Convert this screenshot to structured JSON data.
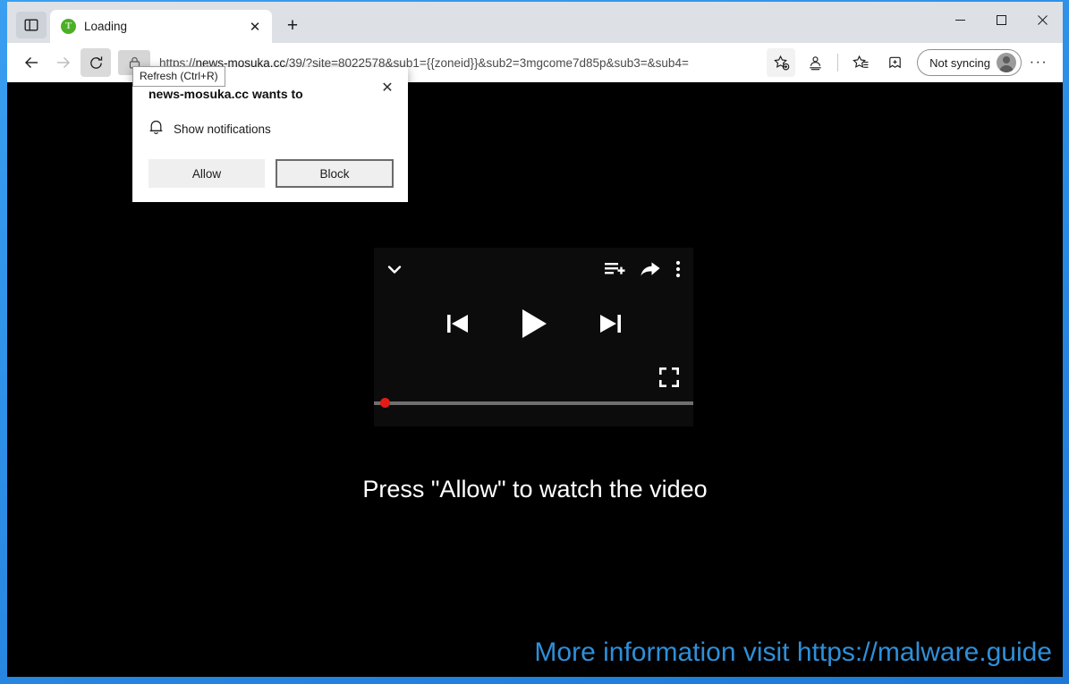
{
  "window": {
    "minimize_label": "—",
    "maximize_label": "☐",
    "close_label": "✕"
  },
  "tabstrip": {
    "tab_search_icon": "tab-search-icon",
    "tabs": [
      {
        "title": "Loading",
        "favicon_letter": "T",
        "favicon_color": "#4caf28",
        "close_label": "✕"
      }
    ],
    "new_tab_label": "+"
  },
  "navbar": {
    "back_label": "←",
    "forward_label": "→",
    "refresh_label": "⟳",
    "url_scheme": "https://",
    "url_host": "news-mosuka.cc",
    "url_path": "/39/?site=8022578&sub1={{zoneid}}&sub2=3mgcome7d85p&sub3=&sub4=",
    "profile_label": "Not syncing",
    "settings_label": "···"
  },
  "tooltip": {
    "text": "Refresh (Ctrl+R)"
  },
  "permission_popup": {
    "title": "news-mosuka.cc wants to",
    "close_label": "✕",
    "request_label": "Show notifications",
    "allow_label": "Allow",
    "block_label": "Block"
  },
  "player": {
    "collapse_icon": "chevron-down-icon",
    "queue_icon": "add-to-queue-icon",
    "share_icon": "share-icon",
    "more_icon": "kebab-menu-icon",
    "previous_icon": "previous-track-icon",
    "play_icon": "play-icon",
    "next_icon": "next-track-icon",
    "fullscreen_icon": "fullscreen-icon",
    "progress_percent": 0,
    "scrubber_color": "#e41b16",
    "track_color": "#6f6f6f"
  },
  "page": {
    "cta_text": "Press \"Allow\" to watch the video",
    "watermark": "More information visit https://malware.guide",
    "watermark_color": "#2f8fd8",
    "background_color": "#000000"
  }
}
